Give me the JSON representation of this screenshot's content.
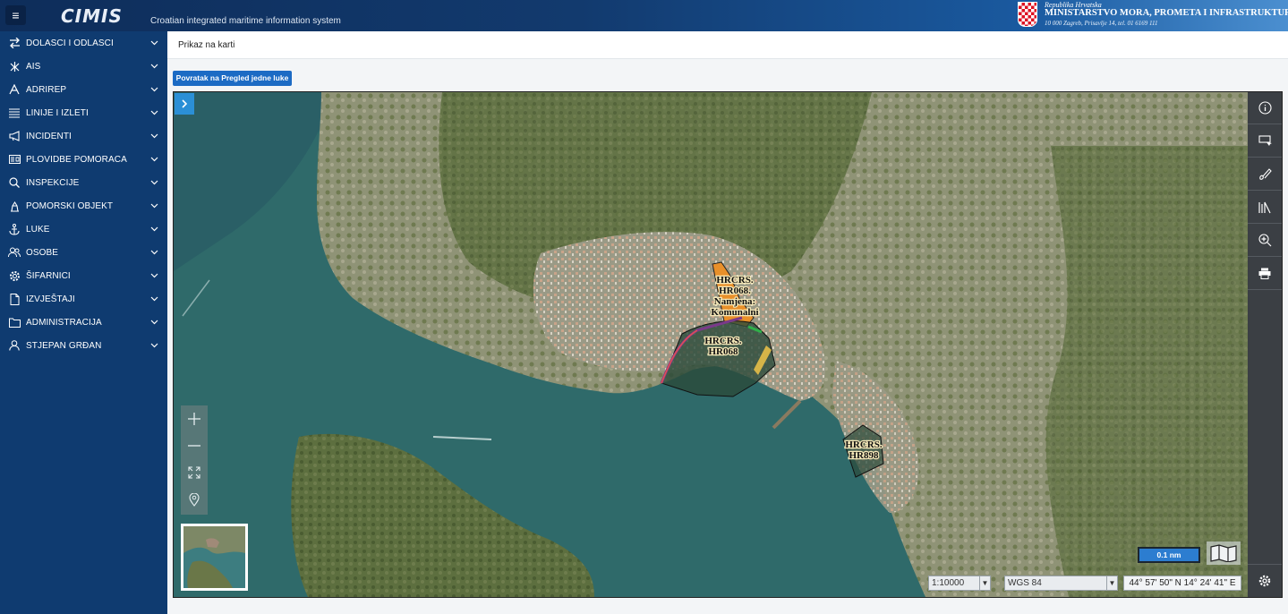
{
  "header": {
    "menu_icon": "hamburger-icon",
    "logo": "CIMIS",
    "tagline": "Croatian integrated maritime information system",
    "ministry_small": "Republika Hrvatska",
    "ministry": "MINISTARSTVO MORA, PROMETA I INFRASTRUKTURE",
    "ministry_addr": "10 000 Zagreb, Prisavlje 14, tel. 01 6169 111"
  },
  "sidebar": {
    "items": [
      {
        "label": "DOLASCI I ODLASCI",
        "icon": "arrows-exchange-icon"
      },
      {
        "label": "AIS",
        "icon": "signal-icon"
      },
      {
        "label": "ADRIREP",
        "icon": "letter-a-icon"
      },
      {
        "label": "LINIJE I IZLETI",
        "icon": "list-icon"
      },
      {
        "label": "INCIDENTI",
        "icon": "megaphone-icon"
      },
      {
        "label": "PLOVIDBE POMORACA",
        "icon": "id-card-icon"
      },
      {
        "label": "INSPEKCIJE",
        "icon": "search-icon"
      },
      {
        "label": "POMORSKI OBJEKT",
        "icon": "lighthouse-icon"
      },
      {
        "label": "LUKE",
        "icon": "anchor-icon"
      },
      {
        "label": "OSOBE",
        "icon": "people-icon"
      },
      {
        "label": "ŠIFARNICI",
        "icon": "gear-icon"
      },
      {
        "label": "IZVJEŠTAJI",
        "icon": "document-icon"
      },
      {
        "label": "ADMINISTRACIJA",
        "icon": "folder-icon"
      },
      {
        "label": "STJEPAN GRĐAN",
        "icon": "user-icon"
      }
    ]
  },
  "breadcrumb": "Prikaz na karti",
  "back_button": "Povratak na Pregled jedne luke",
  "map": {
    "zones": [
      {
        "lines": [
          "HRCRS.",
          "HR068.",
          "Namjena:",
          "Komunalni"
        ]
      },
      {
        "lines": [
          "HRCRS.",
          "HR068"
        ]
      },
      {
        "lines": [
          "HRCRS.",
          "HR898"
        ]
      }
    ],
    "toolbar": [
      "info-icon",
      "select-area-icon",
      "draw-icon",
      "layers-icon",
      "zoom-in-icon",
      "print-icon",
      "settings-icon"
    ],
    "scale": "0.1 nm",
    "scale_select": "1:10000",
    "crs_select": "WGS 84",
    "coordinates": "44° 57' 50\" N 14° 24' 41\" E"
  }
}
